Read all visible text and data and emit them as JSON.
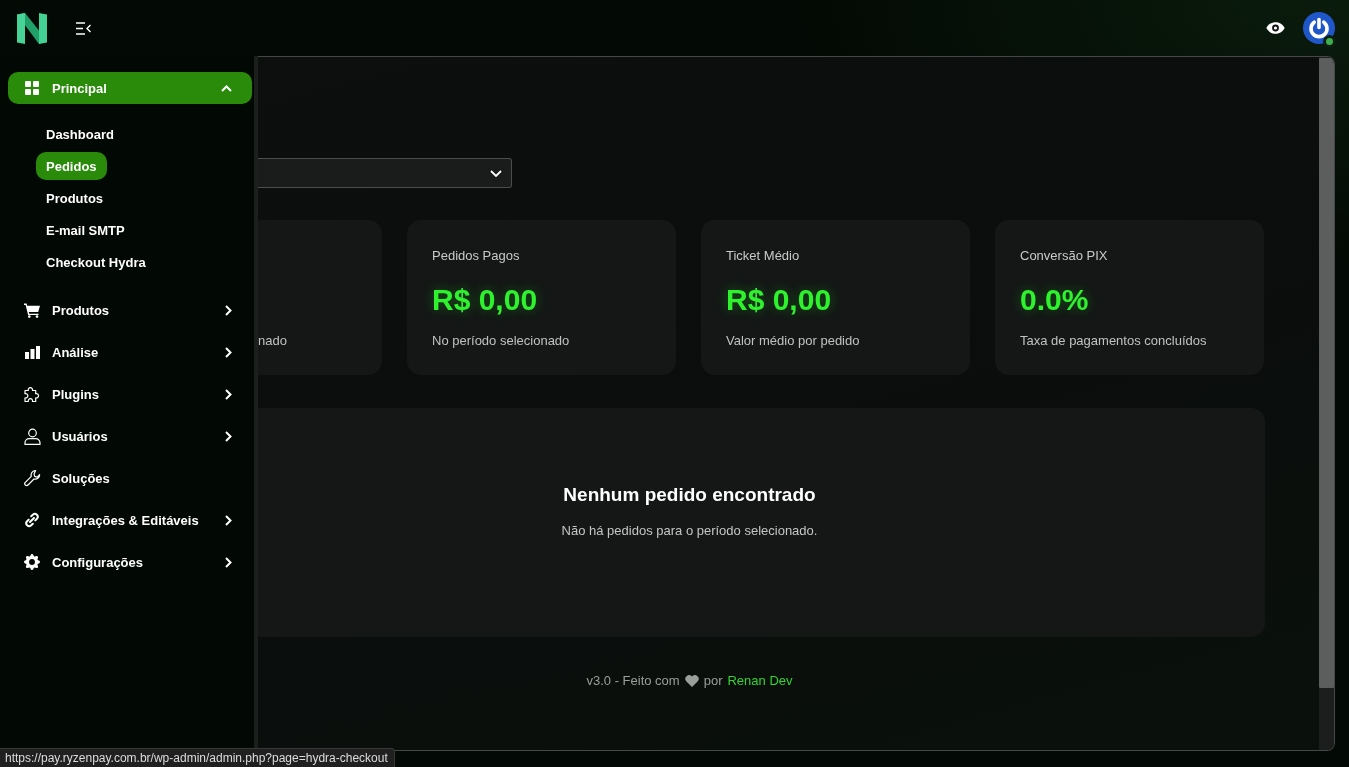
{
  "header": {
    "user": {
      "online": true
    }
  },
  "sidebar": {
    "items": [
      {
        "label": "Principal",
        "kind": "menu",
        "selected": true,
        "expanded": true,
        "children": [
          {
            "label": "Dashboard",
            "selected": false
          },
          {
            "label": "Pedidos",
            "selected": true
          },
          {
            "label": "Produtos",
            "selected": false
          },
          {
            "label": "E-mail SMTP",
            "selected": false
          },
          {
            "label": "Checkout Hydra",
            "selected": false
          }
        ]
      },
      {
        "label": "Produtos",
        "kind": "menu",
        "selected": false,
        "expanded": false
      },
      {
        "label": "Análise",
        "kind": "menu",
        "selected": false,
        "expanded": false
      },
      {
        "label": "Plugins",
        "kind": "menu",
        "selected": false,
        "expanded": false
      },
      {
        "label": "Usuários",
        "kind": "menu",
        "selected": false,
        "expanded": false
      },
      {
        "label": "Soluções",
        "kind": "link",
        "selected": false
      },
      {
        "label": "Integrações & Editáveis",
        "kind": "menu",
        "selected": false,
        "expanded": false
      },
      {
        "label": "Configurações",
        "kind": "menu",
        "selected": false,
        "expanded": false
      }
    ]
  },
  "stat_cards": [
    {
      "subtitle": "nado"
    },
    {
      "title": "Pedidos Pagos",
      "value": "R$ 0,00",
      "subtitle": "No período selecionado"
    },
    {
      "title": "Ticket Médio",
      "value": "R$ 0,00",
      "subtitle": "Valor médio por pedido"
    },
    {
      "title": "Conversão PIX",
      "value": "0.0%",
      "subtitle": "Taxa de pagamentos concluídos"
    }
  ],
  "empty_state": {
    "title": "Nenhum pedido encontrado",
    "message": "Não há pedidos para o período selecionado."
  },
  "footer": {
    "version_text": "v3.0 - Feito com",
    "by_text": "por",
    "author_link": "Renan Dev"
  },
  "status_bar": {
    "url": "https://pay.ryzenpay.com.br/wp-admin/admin.php?page=hydra-checkout"
  }
}
